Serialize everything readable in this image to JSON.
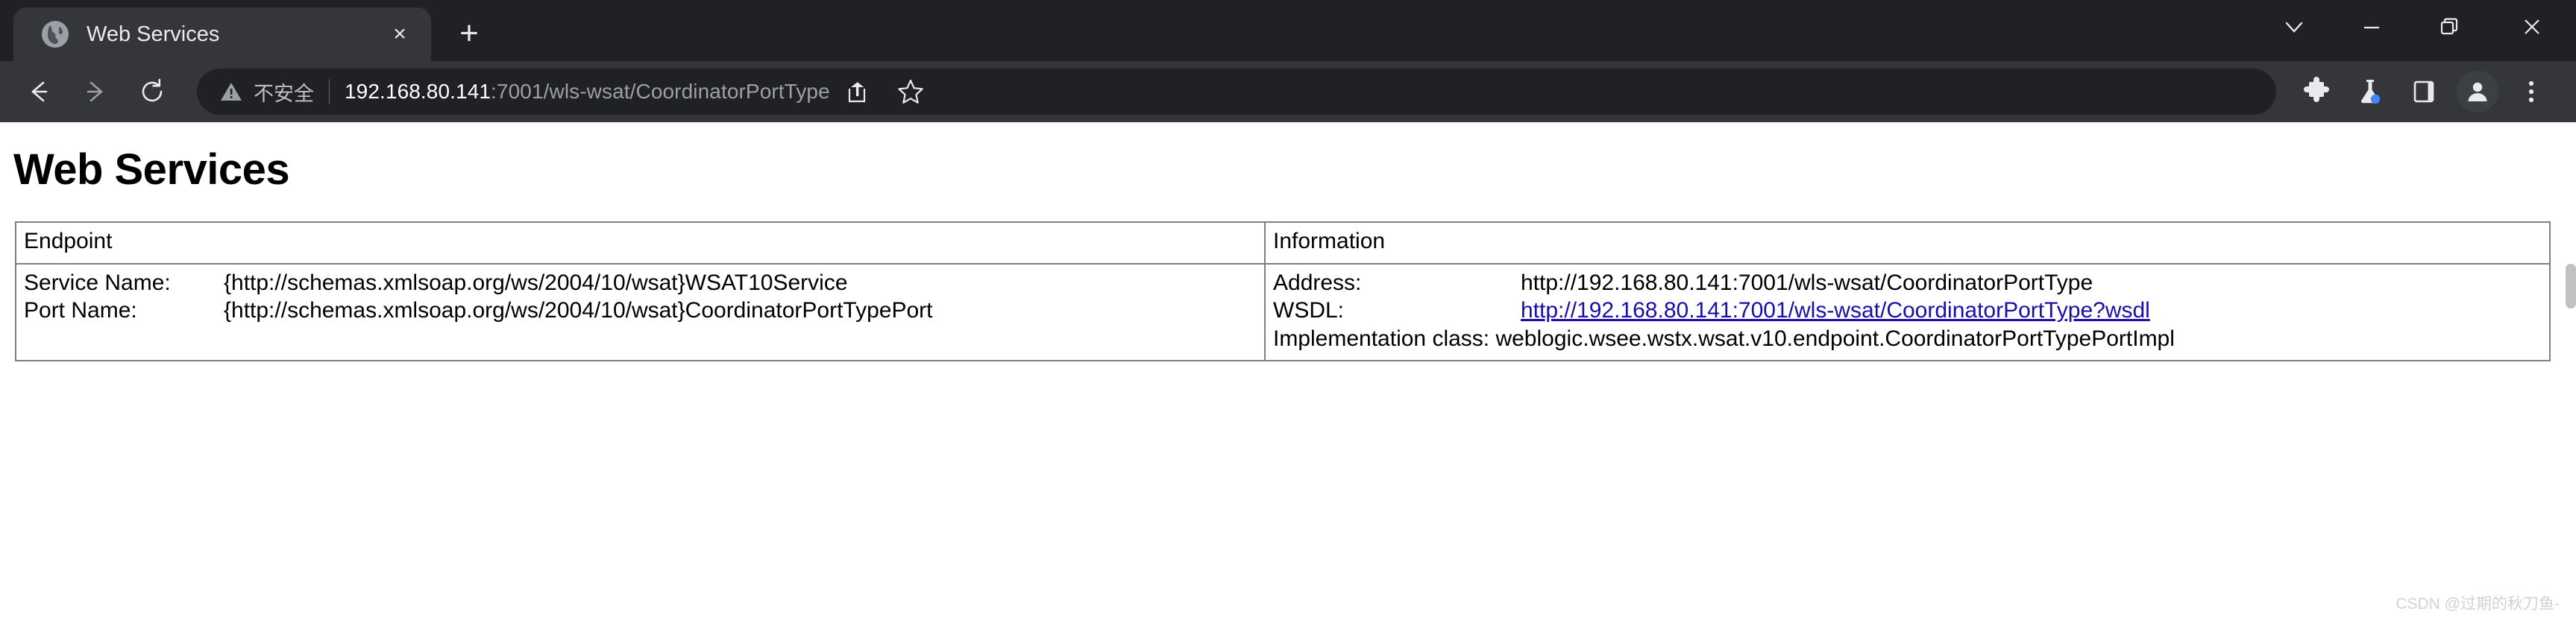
{
  "browser": {
    "tab": {
      "title": "Web Services",
      "favicon_name": "globe-favicon",
      "close_glyph": "×"
    },
    "new_tab_glyph": "+",
    "window_controls": [
      {
        "name": "tab-search-button",
        "glyph": "chevron-down"
      },
      {
        "name": "minimize-button",
        "glyph": "minimize"
      },
      {
        "name": "restore-button",
        "glyph": "restore"
      },
      {
        "name": "close-window-button",
        "glyph": "close"
      }
    ],
    "nav": {
      "back_label": "←",
      "forward_label": "→",
      "reload_label": "↻"
    },
    "omnibox": {
      "security_text": "不安全",
      "security_icon": "warning-triangle-icon",
      "url_host": "192.168.80.141",
      "url_rest": ":7001/wls-wsat/CoordinatorPortType",
      "full_url": "192.168.80.141:7001/wls-wsat/CoordinatorPortType"
    },
    "toolbar_icons": [
      {
        "name": "share-icon"
      },
      {
        "name": "bookmark-star-icon"
      },
      {
        "name": "extensions-puzzle-icon"
      },
      {
        "name": "labs-flask-icon"
      },
      {
        "name": "side-panel-icon"
      },
      {
        "name": "profile-avatar-icon"
      },
      {
        "name": "more-menu-icon"
      }
    ]
  },
  "page": {
    "heading": "Web Services",
    "table": {
      "headers": {
        "endpoint": "Endpoint",
        "information": "Information"
      },
      "endpoint": {
        "service_name_label": "Service Name:",
        "service_name_value": "{http://schemas.xmlsoap.org/ws/2004/10/wsat}WSAT10Service",
        "port_name_label": "Port Name:",
        "port_name_value": "{http://schemas.xmlsoap.org/ws/2004/10/wsat}CoordinatorPortTypePort"
      },
      "information": {
        "address_label": "Address:",
        "address_value": "http://192.168.80.141:7001/wls-wsat/CoordinatorPortType",
        "wsdl_label": "WSDL:",
        "wsdl_value": "http://192.168.80.141:7001/wls-wsat/CoordinatorPortType?wsdl",
        "impl_line": "Implementation class: weblogic.wsee.wstx.wsat.v10.endpoint.CoordinatorPortTypePortImpl"
      }
    },
    "watermark": "CSDN @过期的秋刀鱼-"
  },
  "colors": {
    "chrome_bg": "#202124",
    "toolbar_bg": "#35363a",
    "link_blue": "#1a0dab",
    "table_border": "#808080"
  }
}
